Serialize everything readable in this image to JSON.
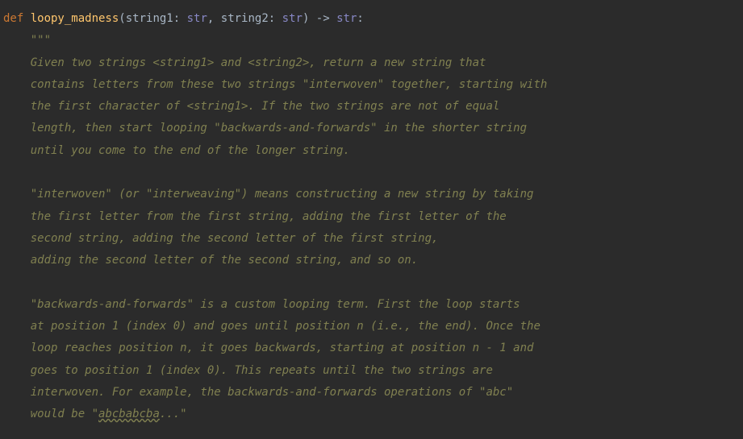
{
  "code": {
    "def_keyword": "def ",
    "function_name": "loopy_madness",
    "open_paren": "(",
    "param1_name": "string1",
    "colon1": ": ",
    "param1_type": "str",
    "comma": ", ",
    "param2_name": "string2",
    "colon2": ": ",
    "param2_type": "str",
    "close_paren": ")",
    "arrow": " -> ",
    "return_type": "str",
    "end_colon": ":",
    "docstring_open": "    \"\"\"",
    "doc_line1": "    Given two strings <string1> and <string2>, return a new string that",
    "doc_line2": "    contains letters from these two strings \"interwoven\" together, starting with",
    "doc_line3": "    the first character of <string1>. If the two strings are not of equal",
    "doc_line4": "    length, then start looping \"backwards-and-forwards\" in the shorter string",
    "doc_line5": "    until you come to the end of the longer string.",
    "doc_blank1": "",
    "doc_line6": "    \"interwoven\" (or \"interweaving\") means constructing a new string by taking",
    "doc_line7": "    the first letter from the first string, adding the first letter of the",
    "doc_line8": "    second string, adding the second letter of the first string,",
    "doc_line9": "    adding the second letter of the second string, and so on.",
    "doc_blank2": "",
    "doc_line10": "    \"backwards-and-forwards\" is a custom looping term. First the loop starts",
    "doc_line11": "    at position 1 (index 0) and goes until position n (i.e., the end). Once the",
    "doc_line12": "    loop reaches position n, it goes backwards, starting at position n - 1 and",
    "doc_line13": "    goes to position 1 (index 0). This repeats until the two strings are",
    "doc_line14": "    interwoven. For example, the backwards-and-forwards operations of \"abc\"",
    "doc_line15a": "    would be \"",
    "doc_line15b": "abcbabcba",
    "doc_line15c": "...\""
  }
}
